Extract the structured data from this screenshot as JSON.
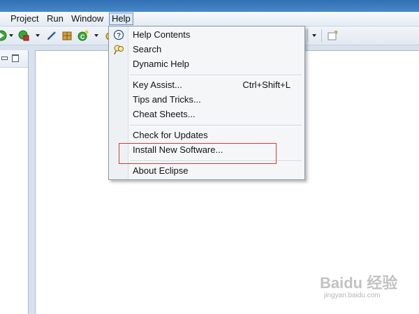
{
  "menubar": {
    "items": [
      {
        "label": "Project"
      },
      {
        "label": "Run"
      },
      {
        "label": "Window"
      },
      {
        "label": "Help"
      }
    ]
  },
  "help_menu": {
    "items": [
      {
        "label": "Help Contents",
        "icon": "help-contents-icon"
      },
      {
        "label": "Search",
        "icon": "search-icon"
      },
      {
        "label": "Dynamic Help"
      },
      {
        "label": "Key Assist...",
        "shortcut": "Ctrl+Shift+L"
      },
      {
        "label": "Tips and Tricks..."
      },
      {
        "label": "Cheat Sheets..."
      },
      {
        "label": "Check for Updates"
      },
      {
        "label": "Install New Software..."
      },
      {
        "label": "About Eclipse"
      }
    ],
    "highlighted_item": "Install New Software...",
    "highlight_color": "#d9383a"
  },
  "watermark": {
    "logo": "Baidu 经验",
    "url": "jingyan.baidu.com"
  },
  "colors": {
    "title_bar": "#3a7bbd",
    "menu_active_border": "#6e8fb8"
  }
}
